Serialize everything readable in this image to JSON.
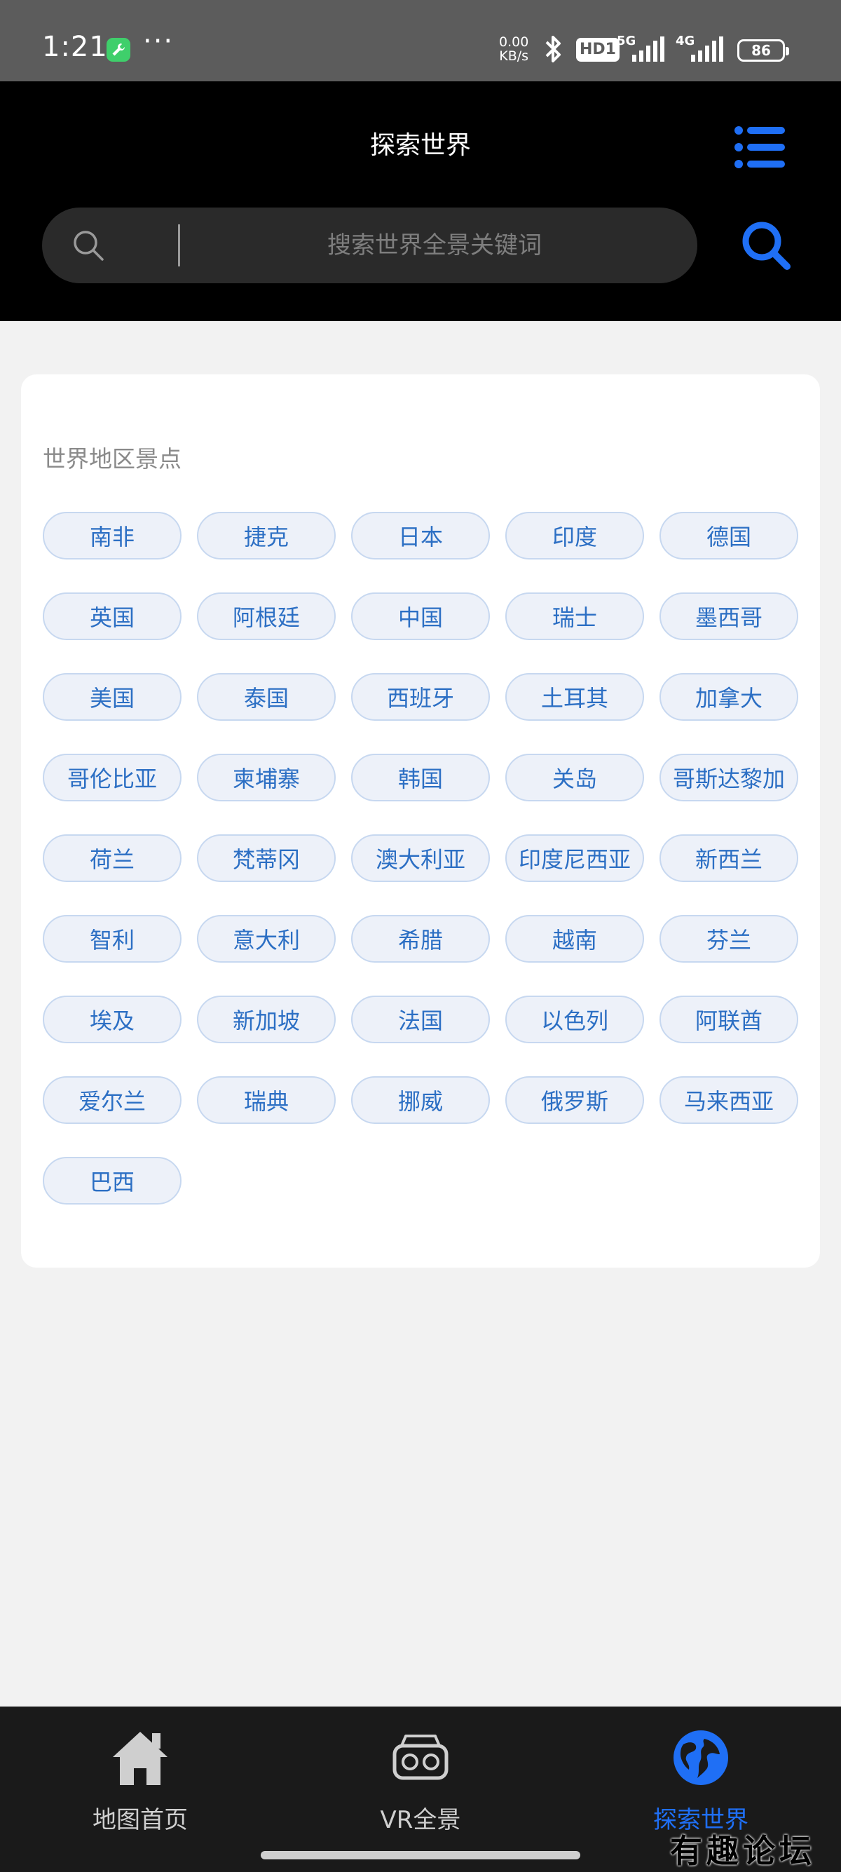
{
  "status_bar": {
    "time": "1:21",
    "dots": "···",
    "speed_value": "0.00",
    "speed_unit": "KB/s",
    "hd_badge": "HD1",
    "network1": "5G",
    "network2": "4G",
    "battery": "86"
  },
  "header": {
    "title": "探索世界",
    "search_placeholder": "搜索世界全景关键词"
  },
  "card": {
    "title": "世界地区景点",
    "tags": [
      "南非",
      "捷克",
      "日本",
      "印度",
      "德国",
      "英国",
      "阿根廷",
      "中国",
      "瑞士",
      "墨西哥",
      "美国",
      "泰国",
      "西班牙",
      "土耳其",
      "加拿大",
      "哥伦比亚",
      "柬埔寨",
      "韩国",
      "关岛",
      "哥斯达黎加",
      "荷兰",
      "梵蒂冈",
      "澳大利亚",
      "印度尼西亚",
      "新西兰",
      "智利",
      "意大利",
      "希腊",
      "越南",
      "芬兰",
      "埃及",
      "新加坡",
      "法国",
      "以色列",
      "阿联酋",
      "爱尔兰",
      "瑞典",
      "挪威",
      "俄罗斯",
      "马来西亚",
      "巴西"
    ]
  },
  "bottom_nav": {
    "items": [
      {
        "label": "地图首页",
        "icon": "home-icon",
        "active": false
      },
      {
        "label": "VR全景",
        "icon": "vr-headset-icon",
        "active": false
      },
      {
        "label": "探索世界",
        "icon": "globe-icon",
        "active": true
      }
    ]
  },
  "watermark": "有趣论坛",
  "colors": {
    "accent": "#1f6ff5",
    "tag_text": "#2c6fc4",
    "tag_bg": "#edf1f9",
    "header_bg": "#000000"
  }
}
